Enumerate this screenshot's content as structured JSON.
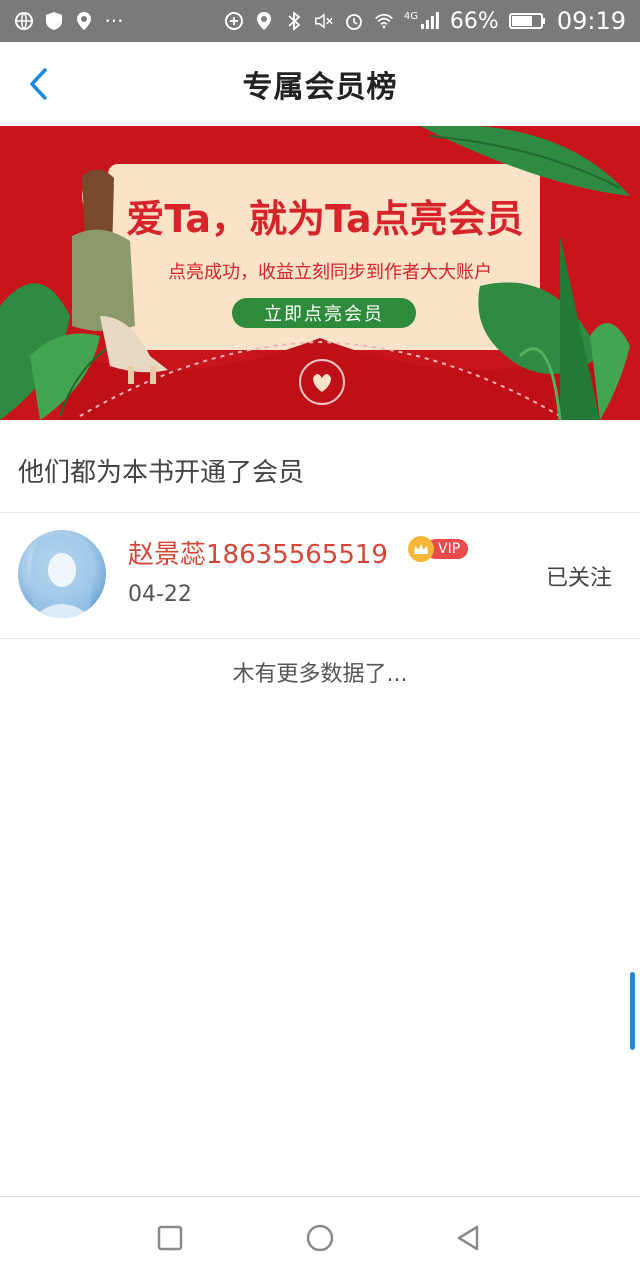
{
  "status_bar": {
    "left_icons": [
      "globe-icon",
      "shield-icon",
      "location-icon",
      "more-dots-icon"
    ],
    "more_dots": "···",
    "right_icons": [
      "data-saver-icon",
      "location-icon",
      "bluetooth-icon",
      "mute-icon",
      "alarm-icon",
      "wifi-icon",
      "signal-4g-icon",
      "battery-icon"
    ],
    "network": "4G",
    "battery_percent": "66%",
    "time": "09:19"
  },
  "header": {
    "back_icon": "chevron-left-icon",
    "title": "专属会员榜"
  },
  "banner": {
    "headline": "爱Ta，就为Ta点亮会员",
    "subtitle": "点亮成功，收益立刻同步到作者大大账户",
    "button_label": "立即点亮会员",
    "colors": {
      "background": "#c8151b",
      "card": "#fbe3c9",
      "accent_green": "#2e8b3c"
    }
  },
  "section": {
    "title": "他们都为本书开通了会员"
  },
  "members": [
    {
      "name": "赵景蕊18635565519",
      "vip_label": "VIP",
      "date": "04-22",
      "follow_label": "已关注"
    }
  ],
  "footer_text": "木有更多数据了...",
  "nav": {
    "icons": [
      "recent-apps-icon",
      "home-icon",
      "back-triangle-icon"
    ]
  },
  "colors": {
    "name_red": "#d64636",
    "accent_blue": "#1e88e5"
  }
}
